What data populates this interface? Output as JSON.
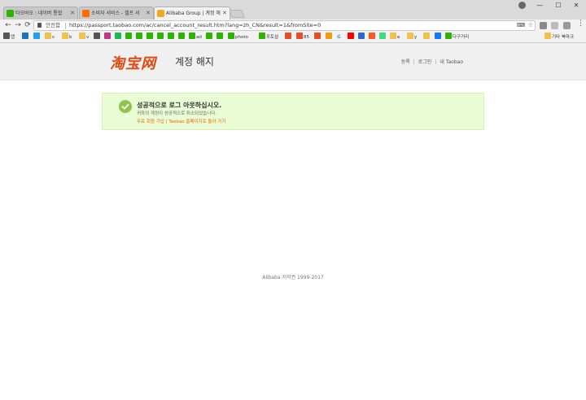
{
  "browser": {
    "tabs": [
      {
        "title": "타오바오 : 네이버 통합",
        "favicon_color": "#2db400"
      },
      {
        "title": "소비자 서비스 - 셀프 서",
        "favicon_color": "#ff6a00"
      },
      {
        "title": "Alibaba Group | 계정 해",
        "favicon_color": "#f5a623"
      }
    ],
    "window_controls": {
      "minimize": "—",
      "maximize": "☐",
      "close": "✕"
    },
    "nav": {
      "back": "←",
      "forward": "→",
      "reload": "⟳"
    },
    "address": {
      "secure_label": "안전함",
      "url": "https://passport.taobao.com/ac/cancel_account_result.htm?lang=zh_CN&result=1&fromSite=0"
    },
    "bookmarks": [
      {
        "label": "앱",
        "color": "#555"
      },
      {
        "label": "",
        "color": "#1b75bc"
      },
      {
        "label": "",
        "color": "#1da1f2"
      },
      {
        "label": "s",
        "color": "#f0c24b"
      },
      {
        "label": "b",
        "color": "#f0c24b"
      },
      {
        "label": "v",
        "color": "#f0c24b"
      },
      {
        "label": "",
        "color": "#555"
      },
      {
        "label": "",
        "color": "#c13584"
      },
      {
        "label": "",
        "color": "#1db954"
      },
      {
        "label": "",
        "color": "#2db400"
      },
      {
        "label": "",
        "color": "#2db400"
      },
      {
        "label": "",
        "color": "#2db400"
      },
      {
        "label": "ad",
        "color": "#2db400"
      },
      {
        "label": "",
        "color": "#2db400"
      },
      {
        "label": "",
        "color": "#2db400"
      },
      {
        "label": "photo",
        "color": "#2db400"
      },
      {
        "label": "포토샵",
        "color": "#2db400"
      },
      {
        "label": "",
        "color": "#e34f26"
      },
      {
        "label": "85",
        "color": "#e34f26"
      },
      {
        "label": "",
        "color": "#e34f26"
      },
      {
        "label": "",
        "color": "#f39c12"
      },
      {
        "label": "G",
        "color": "#ffffff"
      },
      {
        "label": "",
        "color": "#ff0000"
      },
      {
        "label": "",
        "color": "#3366cc"
      },
      {
        "label": "",
        "color": "#ff5722"
      },
      {
        "label": "",
        "color": "#3ddc84"
      },
      {
        "label": "e",
        "color": "#f0c24b"
      },
      {
        "label": "y",
        "color": "#f0c24b"
      },
      {
        "label": "",
        "color": "#1877f2"
      },
      {
        "label": "다구거리",
        "color": "#2db400"
      },
      {
        "label": "기타 북마크",
        "color": "#f0c24b"
      }
    ]
  },
  "header": {
    "logo": "淘宝网",
    "title": "계정 해지",
    "links": [
      "등록",
      "로그인",
      "내 Taobao"
    ]
  },
  "notice": {
    "title": "성공적으로 로그 아웃하십시오.",
    "subtitle": "귀하의 계정이 성공적으로 취소되었습니다.",
    "links": "무료 회원 가입 | Taobao 홈페이지로 돌아 가기"
  },
  "footer": {
    "copyright": "Alibaba 저작권 1999-2017"
  }
}
